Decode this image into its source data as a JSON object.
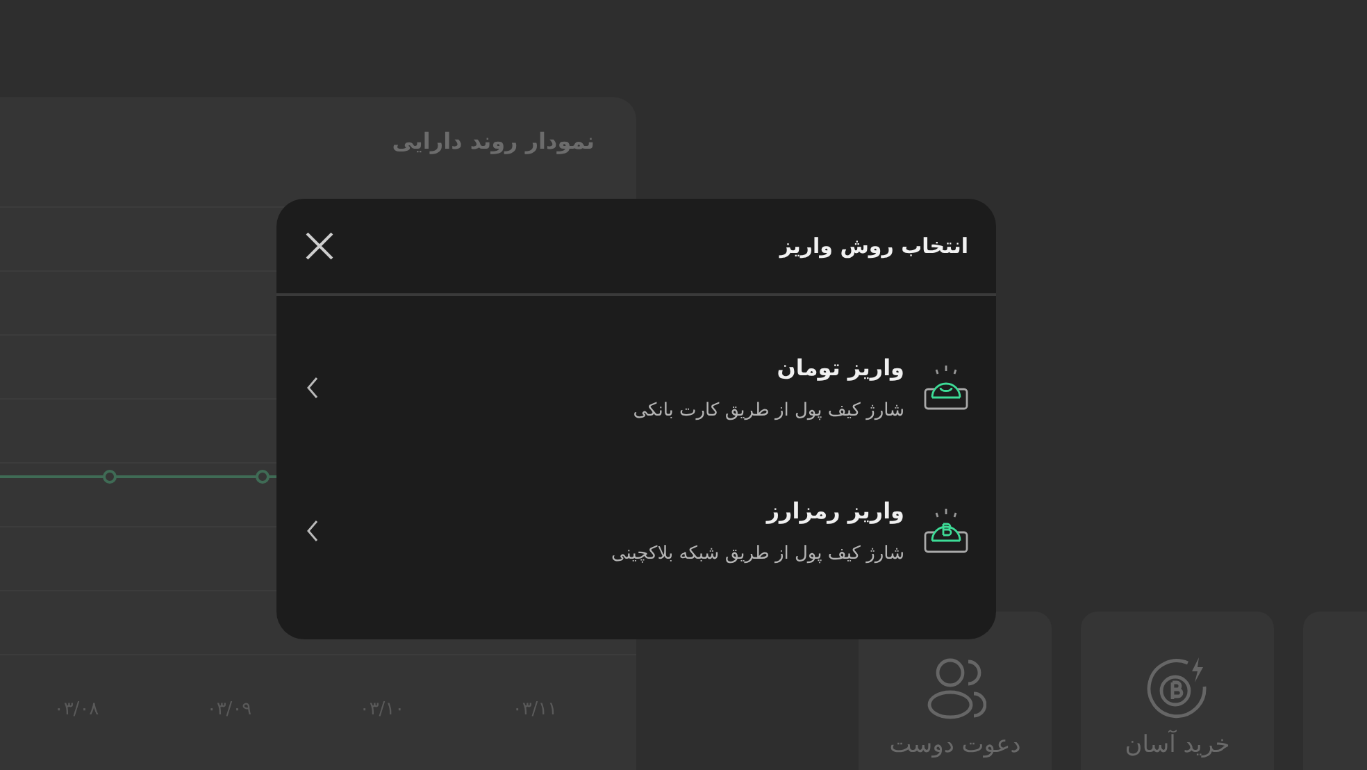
{
  "chart": {
    "title": "نمودار روند دارایی",
    "x_labels": [
      "۰۳/۱۱",
      "۰۳/۱۰",
      "۰۳/۰۹",
      "۰۳/۰۸"
    ]
  },
  "actions": [
    {
      "kind": "bitcoin",
      "label": "خرید آسان"
    },
    {
      "kind": "users",
      "label": "دعوت دوست"
    }
  ],
  "modal": {
    "title": "انتخاب روش واریز",
    "options": [
      {
        "kind": "toman",
        "title": "واریز تومان",
        "subtitle": "شارژ کیف پول از طریق کارت بانکی"
      },
      {
        "kind": "crypto",
        "title": "واریز رمزارز",
        "subtitle": "شارژ کیف پول از طریق شبکه بلاکچینی"
      }
    ]
  }
}
